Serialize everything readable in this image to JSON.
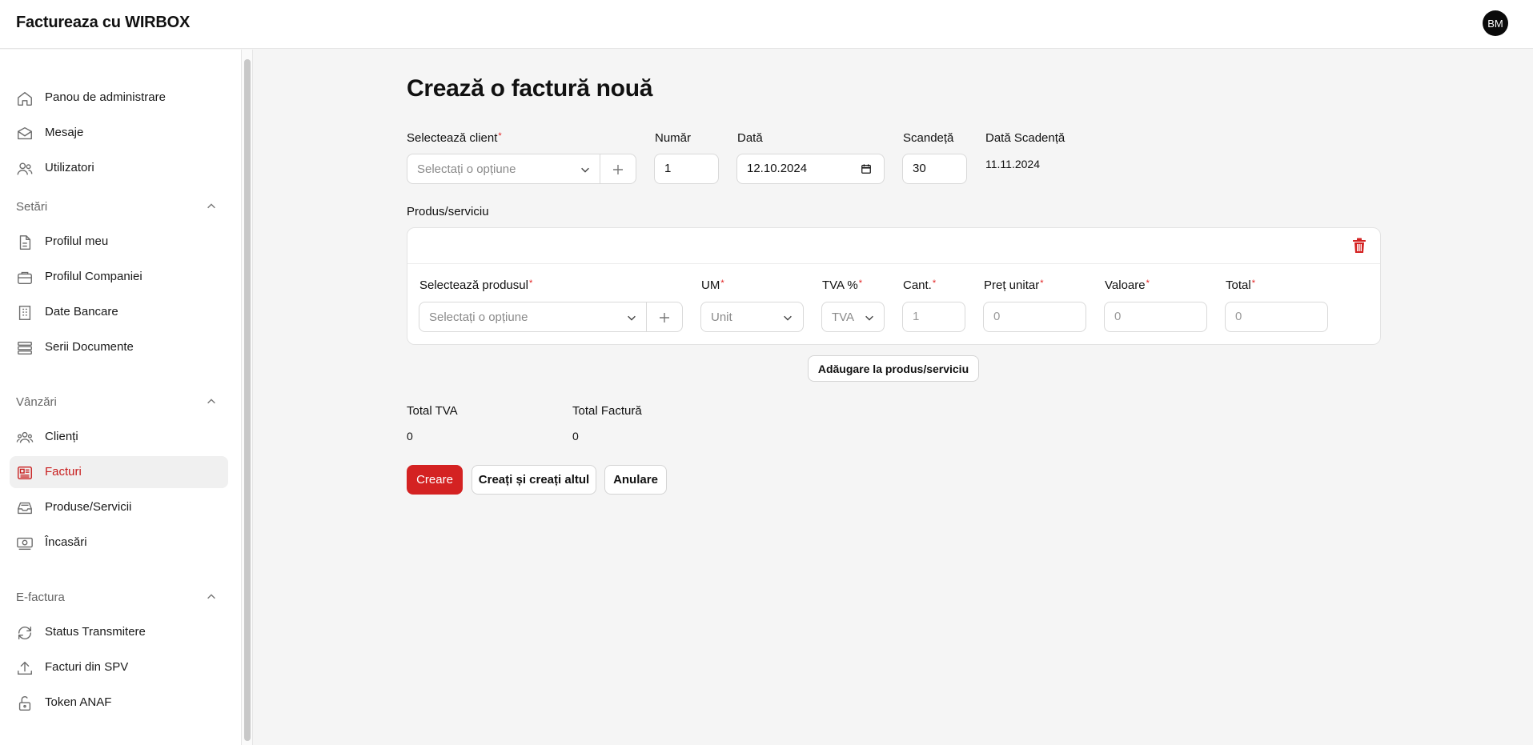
{
  "app": {
    "title": "Factureaza cu WIRBOX",
    "user_initials": "BM"
  },
  "colors": {
    "accent": "#d42222",
    "required": "#e11d1d"
  },
  "sidebar": {
    "top_items": [
      {
        "label": "Panou de administrare",
        "icon": "home-icon"
      },
      {
        "label": "Mesaje",
        "icon": "mail-icon"
      },
      {
        "label": "Utilizatori",
        "icon": "users-icon"
      }
    ],
    "groups": [
      {
        "label": "Setări",
        "items": [
          {
            "label": "Profilul meu",
            "icon": "document-icon"
          },
          {
            "label": "Profilul Companiei",
            "icon": "briefcase-icon"
          },
          {
            "label": "Date Bancare",
            "icon": "building-icon"
          },
          {
            "label": "Serii Documente",
            "icon": "stack-icon"
          }
        ]
      },
      {
        "label": "Vânzări",
        "items": [
          {
            "label": "Clienți",
            "icon": "group-icon"
          },
          {
            "label": "Facturi",
            "icon": "invoice-icon",
            "active": true
          },
          {
            "label": "Produse/Servicii",
            "icon": "inbox-stack-icon"
          },
          {
            "label": "Încasări",
            "icon": "cash-icon"
          }
        ]
      },
      {
        "label": "E-factura",
        "items": [
          {
            "label": "Status Transmitere",
            "icon": "refresh-icon"
          },
          {
            "label": "Facturi din SPV",
            "icon": "upload-icon"
          },
          {
            "label": "Token ANAF",
            "icon": "lock-open-icon"
          }
        ]
      }
    ]
  },
  "form": {
    "heading": "Crează o factură nouă",
    "client": {
      "label": "Selectează client",
      "placeholder": "Selectați o opțiune"
    },
    "number": {
      "label": "Număr",
      "value": "1"
    },
    "date": {
      "label": "Dată",
      "value": "12.10.2024"
    },
    "due_days": {
      "label": "Scandeță",
      "value": "30"
    },
    "due_date": {
      "label": "Dată Scadență",
      "value": "11.11.2024"
    },
    "products_label": "Produs/serviciu",
    "product_row": {
      "product": {
        "label": "Selectează produsul",
        "placeholder": "Selectați o opțiune"
      },
      "um": {
        "label": "UM",
        "placeholder": "Unit"
      },
      "tva": {
        "label": "TVA %",
        "placeholder": "TVA"
      },
      "qty": {
        "label": "Cant.",
        "placeholder": "1"
      },
      "unit_price": {
        "label": "Preț unitar",
        "placeholder": "0"
      },
      "value": {
        "label": "Valoare",
        "placeholder": "0"
      },
      "total": {
        "label": "Total",
        "placeholder": "0"
      }
    },
    "add_product_button": "Adăugare la produs/serviciu",
    "totals": {
      "tva_label": "Total TVA",
      "tva_value": "0",
      "invoice_label": "Total Factură",
      "invoice_value": "0"
    },
    "actions": {
      "create": "Creare",
      "create_another": "Creați și creați altul",
      "cancel": "Anulare"
    }
  }
}
